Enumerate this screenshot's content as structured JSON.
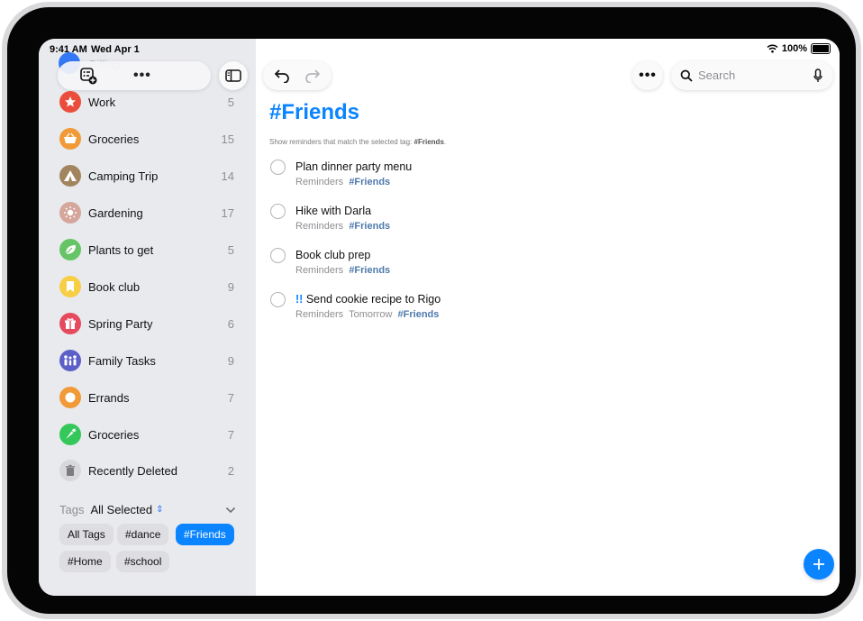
{
  "status_bar": {
    "time": "9:41 AM",
    "date": "Wed Apr 1",
    "battery": "100%"
  },
  "sidebar": {
    "peek_label": "Billing",
    "lists": [
      {
        "name": "Work",
        "count": "5",
        "color": "#eb4d3d",
        "icon": "star-icon"
      },
      {
        "name": "Groceries",
        "count": "15",
        "color": "#f19a37",
        "icon": "basket-icon"
      },
      {
        "name": "Camping Trip",
        "count": "14",
        "color": "#a2845e",
        "icon": "tent-icon"
      },
      {
        "name": "Gardening",
        "count": "17",
        "color": "#d5a69b",
        "icon": "sun-icon"
      },
      {
        "name": "Plants to get",
        "count": "5",
        "color": "#65c466",
        "icon": "leaf-icon"
      },
      {
        "name": "Book club",
        "count": "9",
        "color": "#f7ce46",
        "icon": "bookmark-icon"
      },
      {
        "name": "Spring Party",
        "count": "6",
        "color": "#e64a5f",
        "icon": "gift-icon"
      },
      {
        "name": "Family Tasks",
        "count": "9",
        "color": "#5b5fc7",
        "icon": "family-icon"
      },
      {
        "name": "Errands",
        "count": "7",
        "color": "#f19a37",
        "icon": "circle-icon"
      },
      {
        "name": "Groceries",
        "count": "7",
        "color": "#34c759",
        "icon": "carrot-icon"
      },
      {
        "name": "Recently Deleted",
        "count": "2",
        "color": "#d8d8dc",
        "icon": "trash-icon"
      }
    ],
    "tags": {
      "title": "Tags",
      "filter": "All Selected",
      "chips": [
        "All Tags",
        "#dance",
        "#Friends",
        "#Home",
        "#school"
      ],
      "selected": "#Friends"
    }
  },
  "main": {
    "title": "#Friends",
    "subtitle_prefix": "Show reminders that match the selected tag:",
    "subtitle_tag": "#Friends",
    "search_placeholder": "Search",
    "reminders": [
      {
        "priority": "",
        "title": "Plan dinner party menu",
        "list": "Reminders",
        "date": "",
        "tag": "#Friends"
      },
      {
        "priority": "",
        "title": "Hike with Darla",
        "list": "Reminders",
        "date": "",
        "tag": "#Friends"
      },
      {
        "priority": "",
        "title": "Book club prep",
        "list": "Reminders",
        "date": "",
        "tag": "#Friends"
      },
      {
        "priority": "!!",
        "title": "Send cookie recipe to Rigo",
        "list": "Reminders",
        "date": "Tomorrow",
        "tag": "#Friends"
      }
    ]
  }
}
